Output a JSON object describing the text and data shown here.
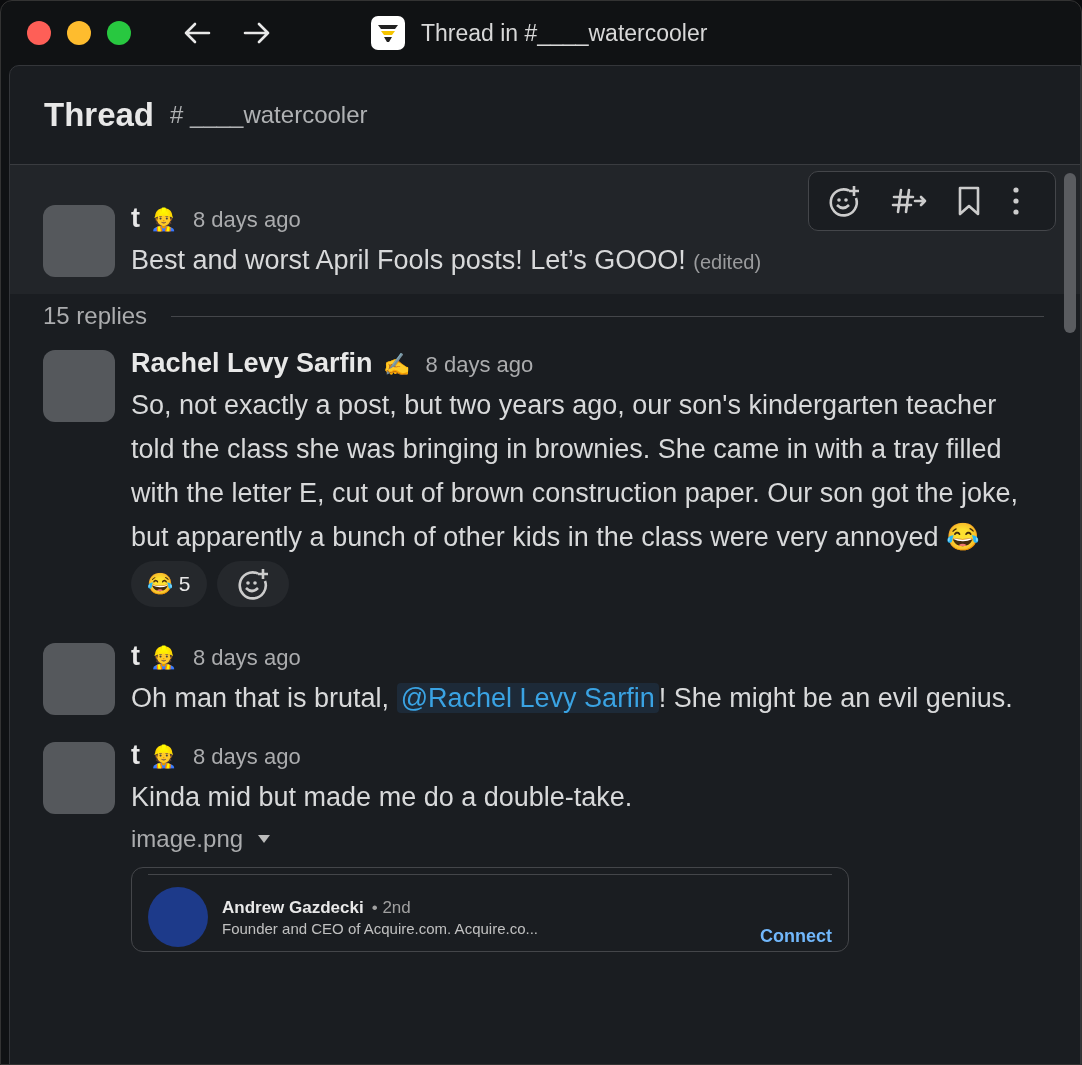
{
  "window": {
    "title": "Thread in #____watercooler"
  },
  "header": {
    "title": "Thread",
    "channel": "# ____watercooler"
  },
  "parent": {
    "author": "t",
    "status_emoji": "👷",
    "time": "8 days ago",
    "hovered": true,
    "body": [
      {
        "kind": "text",
        "text": "Best and worst April Fools posts! Let’s GOOO!"
      }
    ],
    "edited": "(edited)"
  },
  "replies_label": "15 replies",
  "messages": [
    {
      "author": "Rachel Levy Sarfin",
      "status_emoji": "✍️",
      "time": "8 days ago",
      "body": [
        {
          "kind": "text",
          "text": "So, not exactly a post, but two years ago, our son's kindergarten teacher told the class she was bringing in brownies. She came in with a tray filled with the letter E, cut out of brown construction paper. Our son got the joke, but apparently a bunch of other kids in the class were very annoyed 😂"
        }
      ],
      "reactions": [
        {
          "emoji": "😂",
          "count": "5",
          "selected": false
        }
      ]
    },
    {
      "author": "t",
      "status_emoji": "👷",
      "time": "8 days ago",
      "body": [
        {
          "kind": "text",
          "text": "Oh man that is brutal, "
        },
        {
          "kind": "mention",
          "text": "@Rachel Levy Sarfin"
        },
        {
          "kind": "text",
          "text": "! She might be an evil genius."
        }
      ]
    },
    {
      "author": "t",
      "status_emoji": "👷",
      "time": "8 days ago",
      "body": [
        {
          "kind": "text",
          "text": "Kinda mid but made me do a double-take."
        }
      ],
      "attachment": {
        "filename": "image.png",
        "expanded": true,
        "preview": {
          "name": "Andrew Gazdecki",
          "degree": "• 2nd",
          "headline": "Founder and CEO of Acquire.com. Acquire.co...",
          "action": "Connect"
        }
      }
    }
  ]
}
